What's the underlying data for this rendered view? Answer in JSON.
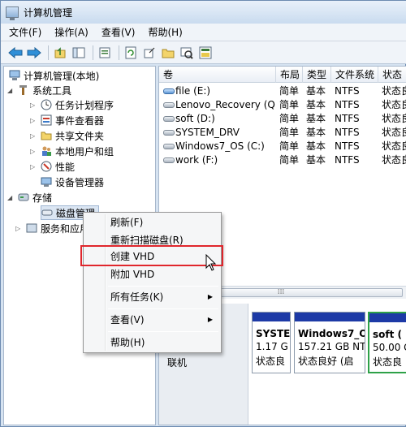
{
  "window": {
    "title": "计算机管理"
  },
  "menubar": [
    {
      "label": "文件(F)"
    },
    {
      "label": "操作(A)"
    },
    {
      "label": "查看(V)"
    },
    {
      "label": "帮助(H)"
    }
  ],
  "toolbar": {
    "icons": [
      "back-icon",
      "forward-icon",
      "up-icon",
      "show-hide-tree-icon",
      "properties-icon",
      "refresh-icon",
      "export-icon",
      "help-icon",
      "settings-icon"
    ]
  },
  "tree": {
    "items": [
      {
        "label": "计算机管理(本地)",
        "icon": "computer-icon"
      },
      {
        "label": "系统工具",
        "icon": "tools-icon"
      },
      {
        "label": "任务计划程序",
        "icon": "clock-icon"
      },
      {
        "label": "事件查看器",
        "icon": "event-viewer-icon"
      },
      {
        "label": "共享文件夹",
        "icon": "shared-folder-icon"
      },
      {
        "label": "本地用户和组",
        "icon": "users-icon"
      },
      {
        "label": "性能",
        "icon": "performance-icon"
      },
      {
        "label": "设备管理器",
        "icon": "device-manager-icon"
      },
      {
        "label": "存储",
        "icon": "storage-icon"
      },
      {
        "label": "磁盘管理",
        "icon": "disk-management-icon"
      },
      {
        "label": "服务和应用",
        "icon": "services-icon"
      }
    ]
  },
  "volume_table": {
    "columns": [
      "卷",
      "布局",
      "类型",
      "文件系统",
      "状态"
    ],
    "rows": [
      {
        "volume": "file (E:)",
        "layout": "简单",
        "type": "基本",
        "fs": "NTFS",
        "status": "状态良"
      },
      {
        "volume": "Lenovo_Recovery (Q:)",
        "layout": "简单",
        "type": "基本",
        "fs": "NTFS",
        "status": "状态良"
      },
      {
        "volume": "soft (D:)",
        "layout": "简单",
        "type": "基本",
        "fs": "NTFS",
        "status": "状态良"
      },
      {
        "volume": "SYSTEM_DRV",
        "layout": "简单",
        "type": "基本",
        "fs": "NTFS",
        "status": "状态良"
      },
      {
        "volume": "Windows7_OS (C:)",
        "layout": "简单",
        "type": "基本",
        "fs": "NTFS",
        "status": "状态良"
      },
      {
        "volume": "work (F:)",
        "layout": "简单",
        "type": "基本",
        "fs": "NTFS",
        "status": "状态良"
      }
    ]
  },
  "disk_map": {
    "status_label": "联机",
    "partitions": [
      {
        "name": "SYSTE",
        "size": "1.17 G",
        "status": "状态良"
      },
      {
        "name": "Windows7_O",
        "size": "157.21 GB NT",
        "status": "状态良好 (启"
      },
      {
        "name": "soft (",
        "size": "50.00 G",
        "status": "状态良"
      }
    ]
  },
  "context_menu": {
    "items": [
      {
        "label": "刷新(F)"
      },
      {
        "label": "重新扫描磁盘(R)"
      },
      {
        "label": "创建 VHD"
      },
      {
        "label": "附加 VHD"
      },
      {
        "label": "所有任务(K)"
      },
      {
        "label": "查看(V)"
      },
      {
        "label": "帮助(H)"
      }
    ]
  }
}
